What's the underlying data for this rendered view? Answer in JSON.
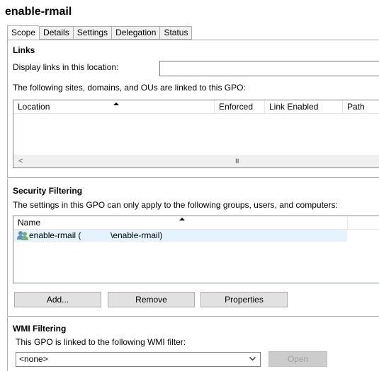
{
  "window": {
    "title": "enable-rmail"
  },
  "tabs": [
    {
      "label": "Scope"
    },
    {
      "label": "Details"
    },
    {
      "label": "Settings"
    },
    {
      "label": "Delegation"
    },
    {
      "label": "Status"
    }
  ],
  "links": {
    "heading": "Links",
    "display_label": "Display links in this location:",
    "display_value": "",
    "linked_text": "The following sites, domains, and OUs are linked to this GPO:",
    "columns": [
      "Location",
      "Enforced",
      "Link Enabled",
      "Path"
    ],
    "scroll_left": "<",
    "scroll_grip": "III"
  },
  "security": {
    "heading": "Security Filtering",
    "desc": "The settings in this GPO can only apply to the following groups, users, and computers:",
    "column": "Name",
    "rows": [
      {
        "name": "enable-rmail (",
        "path": "\\enable-rmail)"
      }
    ],
    "add_label": "Add...",
    "remove_label": "Remove",
    "properties_label": "Properties"
  },
  "wmi": {
    "heading": "WMI Filtering",
    "desc": "This GPO is linked to the following WMI filter:",
    "filter_value": "<none>",
    "open_label": "Open"
  }
}
